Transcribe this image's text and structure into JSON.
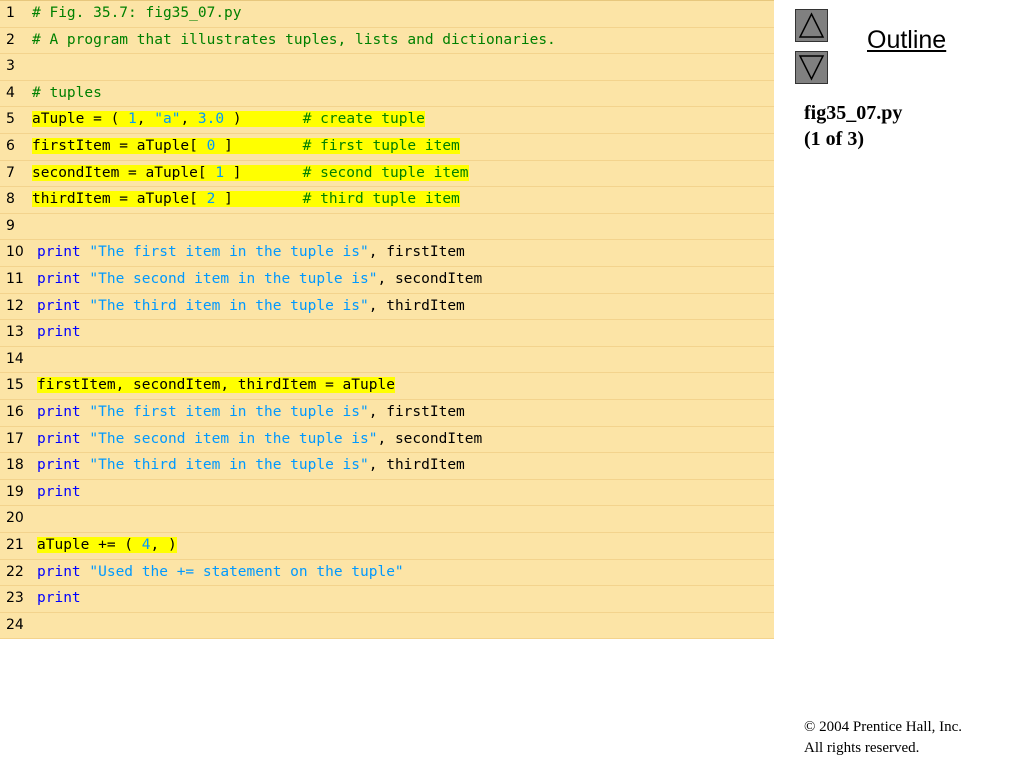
{
  "code": {
    "lines": [
      {
        "num": "1",
        "indent": false,
        "segments": [
          {
            "text": "# Fig. 35.7: fig35_07.py",
            "type": "comment",
            "hl": false
          }
        ]
      },
      {
        "num": "2",
        "indent": false,
        "segments": [
          {
            "text": "# A program that illustrates tuples, lists and dictionaries.",
            "type": "comment",
            "hl": false
          }
        ]
      },
      {
        "num": "3",
        "indent": false,
        "segments": []
      },
      {
        "num": "4",
        "indent": false,
        "segments": [
          {
            "text": "# tuples",
            "type": "comment",
            "hl": false
          }
        ]
      },
      {
        "num": "5",
        "indent": false,
        "segments": [
          {
            "text": "aTuple = ( ",
            "type": "normal",
            "hl": true
          },
          {
            "text": "1",
            "type": "number",
            "hl": true
          },
          {
            "text": ", ",
            "type": "normal",
            "hl": true
          },
          {
            "text": "\"a\"",
            "type": "string",
            "hl": true
          },
          {
            "text": ", ",
            "type": "normal",
            "hl": true
          },
          {
            "text": "3.0",
            "type": "number",
            "hl": true
          },
          {
            "text": " )       ",
            "type": "normal",
            "hl": true
          },
          {
            "text": "# create tuple",
            "type": "comment",
            "hl": true
          }
        ]
      },
      {
        "num": "6",
        "indent": false,
        "segments": [
          {
            "text": "firstItem = aTuple[ ",
            "type": "normal",
            "hl": true
          },
          {
            "text": "0",
            "type": "number",
            "hl": true
          },
          {
            "text": " ]        ",
            "type": "normal",
            "hl": true
          },
          {
            "text": "# first tuple item",
            "type": "comment",
            "hl": true
          }
        ]
      },
      {
        "num": "7",
        "indent": false,
        "segments": [
          {
            "text": "secondItem = aTuple[ ",
            "type": "normal",
            "hl": true
          },
          {
            "text": "1",
            "type": "number",
            "hl": true
          },
          {
            "text": " ]       ",
            "type": "normal",
            "hl": true
          },
          {
            "text": "# second tuple item",
            "type": "comment",
            "hl": true
          }
        ]
      },
      {
        "num": "8",
        "indent": false,
        "segments": [
          {
            "text": "thirdItem = aTuple[ ",
            "type": "normal",
            "hl": true
          },
          {
            "text": "2",
            "type": "number",
            "hl": true
          },
          {
            "text": " ]        ",
            "type": "normal",
            "hl": true
          },
          {
            "text": "# third tuple item",
            "type": "comment",
            "hl": true
          }
        ]
      },
      {
        "num": "9",
        "indent": false,
        "segments": []
      },
      {
        "num": "10",
        "indent": true,
        "segments": [
          {
            "text": "print",
            "type": "keyword",
            "hl": false
          },
          {
            "text": " ",
            "type": "normal",
            "hl": false
          },
          {
            "text": "\"The first item in the tuple is\"",
            "type": "string",
            "hl": false
          },
          {
            "text": ", firstItem",
            "type": "normal",
            "hl": false
          }
        ]
      },
      {
        "num": "11",
        "indent": true,
        "segments": [
          {
            "text": "print",
            "type": "keyword",
            "hl": false
          },
          {
            "text": " ",
            "type": "normal",
            "hl": false
          },
          {
            "text": "\"The second item in the tuple is\"",
            "type": "string",
            "hl": false
          },
          {
            "text": ", secondItem",
            "type": "normal",
            "hl": false
          }
        ]
      },
      {
        "num": "12",
        "indent": true,
        "segments": [
          {
            "text": "print",
            "type": "keyword",
            "hl": false
          },
          {
            "text": " ",
            "type": "normal",
            "hl": false
          },
          {
            "text": "\"The third item in the tuple is\"",
            "type": "string",
            "hl": false
          },
          {
            "text": ", thirdItem",
            "type": "normal",
            "hl": false
          }
        ]
      },
      {
        "num": "13",
        "indent": true,
        "segments": [
          {
            "text": "print",
            "type": "keyword",
            "hl": false
          }
        ]
      },
      {
        "num": "14",
        "indent": false,
        "segments": []
      },
      {
        "num": "15",
        "indent": true,
        "segments": [
          {
            "text": "firstItem, secondItem, thirdItem = aTuple",
            "type": "normal",
            "hl": true
          }
        ]
      },
      {
        "num": "16",
        "indent": true,
        "segments": [
          {
            "text": "print",
            "type": "keyword",
            "hl": false
          },
          {
            "text": " ",
            "type": "normal",
            "hl": false
          },
          {
            "text": "\"The first item in the tuple is\"",
            "type": "string",
            "hl": false
          },
          {
            "text": ", firstItem",
            "type": "normal",
            "hl": false
          }
        ]
      },
      {
        "num": "17",
        "indent": true,
        "segments": [
          {
            "text": "print",
            "type": "keyword",
            "hl": false
          },
          {
            "text": " ",
            "type": "normal",
            "hl": false
          },
          {
            "text": "\"The second item in the tuple is\"",
            "type": "string",
            "hl": false
          },
          {
            "text": ", secondItem",
            "type": "normal",
            "hl": false
          }
        ]
      },
      {
        "num": "18",
        "indent": true,
        "segments": [
          {
            "text": "print",
            "type": "keyword",
            "hl": false
          },
          {
            "text": " ",
            "type": "normal",
            "hl": false
          },
          {
            "text": "\"The third item in the tuple is\"",
            "type": "string",
            "hl": false
          },
          {
            "text": ", thirdItem",
            "type": "normal",
            "hl": false
          }
        ]
      },
      {
        "num": "19",
        "indent": true,
        "segments": [
          {
            "text": "print",
            "type": "keyword",
            "hl": false
          }
        ]
      },
      {
        "num": "20",
        "indent": false,
        "segments": []
      },
      {
        "num": "21",
        "indent": true,
        "segments": [
          {
            "text": "aTuple += ( ",
            "type": "normal",
            "hl": true
          },
          {
            "text": "4",
            "type": "number",
            "hl": true
          },
          {
            "text": ", )",
            "type": "normal",
            "hl": true
          }
        ]
      },
      {
        "num": "22",
        "indent": true,
        "segments": [
          {
            "text": "print",
            "type": "keyword",
            "hl": false
          },
          {
            "text": " ",
            "type": "normal",
            "hl": false
          },
          {
            "text": "\"Used the += statement on the tuple\"",
            "type": "string",
            "hl": false
          }
        ]
      },
      {
        "num": "23",
        "indent": true,
        "segments": [
          {
            "text": "print",
            "type": "keyword",
            "hl": false
          }
        ]
      },
      {
        "num": "24",
        "indent": false,
        "segments": []
      }
    ]
  },
  "nav": {
    "up_icon": "up-triangle-icon",
    "down_icon": "down-triangle-icon",
    "outline_label": "Outline"
  },
  "sidebar": {
    "file_name": "fig35_07.py",
    "page_indicator": "(1 of 3)"
  },
  "footer": {
    "copyright_symbol": "©",
    "copyright_line": " 2004 Prentice Hall, Inc.",
    "rights_line": "All rights reserved."
  },
  "colors": {
    "panel_background": "#fce4a6",
    "highlight": "#ffff00",
    "comment": "#008000",
    "keyword": "#0000ff",
    "string": "#0099ff"
  }
}
